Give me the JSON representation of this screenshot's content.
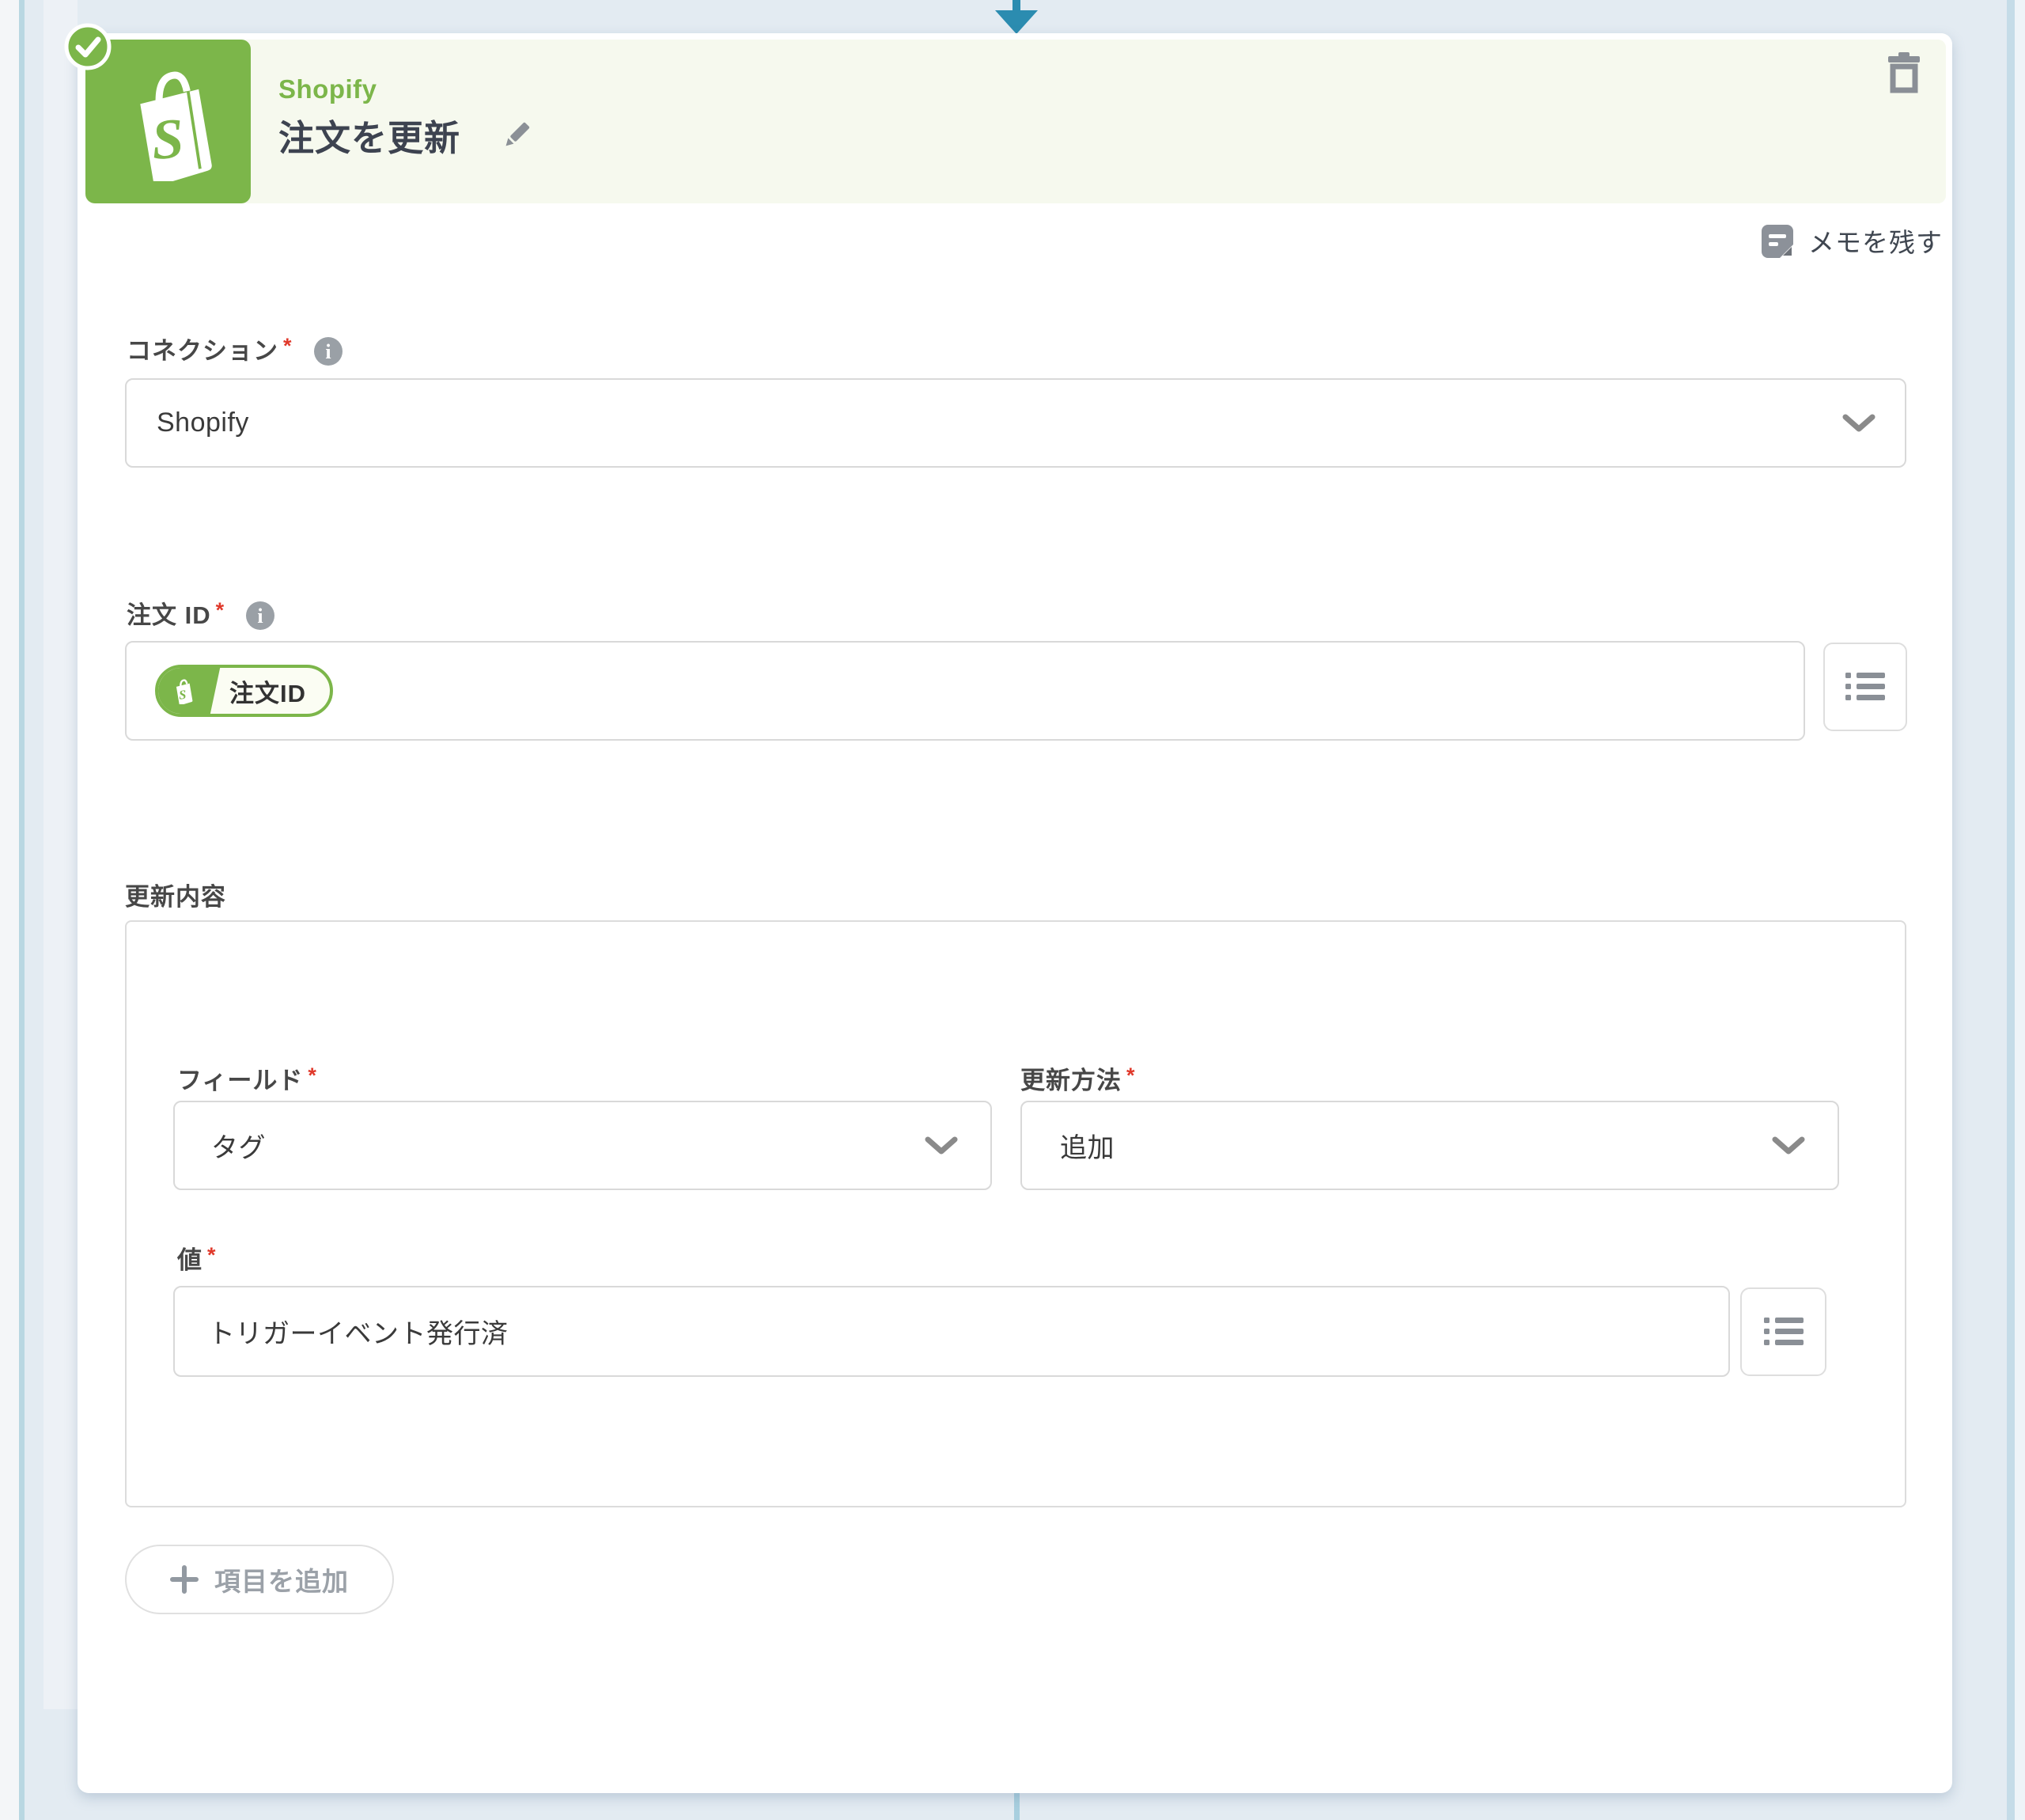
{
  "required_mark": "*",
  "colors": {
    "brand_green": "#7cb64a",
    "header_bg": "#f6f9ee",
    "canvas_bg": "#e3ebf2",
    "arrow_teal": "#2b8cb0",
    "asterisk_red": "#e0392b"
  },
  "card": {
    "service": "Shopify",
    "title": "注文を更新",
    "memo_label": "メモを残す"
  },
  "connection": {
    "label": "コネクション",
    "value": "Shopify"
  },
  "order_id": {
    "label": "注文 ID",
    "token_label": "注文ID"
  },
  "update": {
    "section_label": "更新内容",
    "field_label": "フィールド",
    "field_value": "タグ",
    "method_label": "更新方法",
    "method_value": "追加",
    "value_label": "値",
    "value_text": "トリガーイベント発行済",
    "add_item_label": "項目を追加"
  }
}
